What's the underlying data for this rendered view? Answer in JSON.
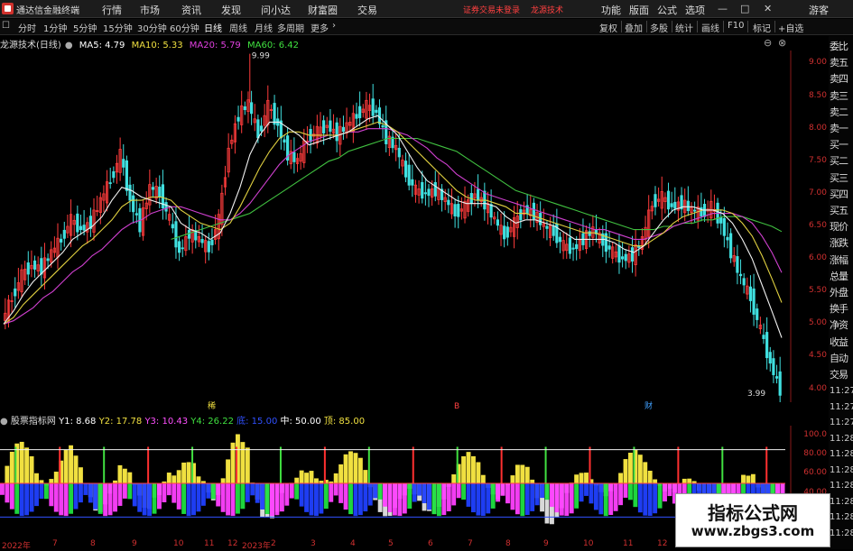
{
  "app": {
    "title": "通达信金融终端"
  },
  "menu": [
    "行情",
    "市场",
    "资讯",
    "发现",
    "问小达",
    "财富圈",
    "交易"
  ],
  "warning": [
    "证券交易未登录",
    "龙源技术"
  ],
  "right_buttons": [
    "功能",
    "版面",
    "公式",
    "选项"
  ],
  "guest": "游客",
  "toolbar": {
    "periods": [
      "分时",
      "1分钟",
      "5分钟",
      "15分钟",
      "30分钟",
      "60分钟",
      "日线",
      "周线",
      "月线",
      "多周期",
      "更多"
    ],
    "active_period": "日线",
    "right": [
      "复权",
      "叠加",
      "多股",
      "统计",
      "画线",
      "F10",
      "标记",
      "+自选"
    ]
  },
  "legend": {
    "name": "龙源技术(日线)",
    "items": [
      {
        "label": "MA5: 4.79",
        "color": "#ffffff"
      },
      {
        "label": "MA10: 5.33",
        "color": "#f0e040"
      },
      {
        "label": "MA20: 5.79",
        "color": "#e040e0"
      },
      {
        "label": "MA60: 6.42",
        "color": "#40e040"
      }
    ]
  },
  "annotations": {
    "high": "9.99",
    "low": "3.99",
    "markers": [
      "稀",
      "B",
      "财"
    ]
  },
  "sublegend": {
    "name": "股票指标网",
    "items": [
      {
        "label": "Y1: 8.68",
        "color": "#ffffff"
      },
      {
        "label": "Y2: 17.78",
        "color": "#f0e040"
      },
      {
        "label": "Y3: 10.43",
        "color": "#ff50ff"
      },
      {
        "label": "Y4: 26.22",
        "color": "#40e040"
      },
      {
        "label": "底: 15.00",
        "color": "#3050ff"
      },
      {
        "label": "中: 50.00",
        "color": "#ffffff"
      },
      {
        "label": "顶: 85.00",
        "color": "#f0e040"
      }
    ]
  },
  "price_axis": [
    "9.00",
    "8.50",
    "8.00",
    "7.50",
    "7.00",
    "6.50",
    "6.00",
    "5.50",
    "5.00",
    "4.50",
    "4.00"
  ],
  "sub_axis": [
    "100.0",
    "80.00",
    "60.00",
    "40.00",
    "20.00"
  ],
  "xaxis": [
    "2022年",
    "7",
    "8",
    "9",
    "10",
    "11",
    "12",
    "2023年",
    "2",
    "3",
    "4",
    "5",
    "6",
    "7",
    "8",
    "9",
    "10",
    "11",
    "12"
  ],
  "sidebar": [
    "委比",
    "卖五",
    "卖四",
    "卖三",
    "卖二",
    "卖一",
    "买一",
    "买二",
    "买三",
    "买四",
    "买五",
    "现价",
    "涨跌",
    "涨幅",
    "总量",
    "外盘",
    "换手",
    "净资",
    "收益",
    "自动",
    "交易"
  ],
  "sidebar_times": [
    "11:27",
    "11:27",
    "11:27",
    "11:28",
    "11:28",
    "11:28",
    "11:28",
    "11:28",
    "11:28",
    "11:28"
  ],
  "watermark": {
    "line1": "指标公式网",
    "line2": "www.zbgs3.com"
  },
  "chart_data": {
    "type": "candlestick",
    "ylim": [
      3.8,
      9.2
    ],
    "close": [
      5.05,
      5.4,
      5.75,
      5.9,
      5.85,
      6.1,
      6.3,
      6.6,
      6.45,
      6.55,
      6.9,
      7.2,
      7.6,
      6.9,
      6.5,
      7.1,
      7.0,
      6.6,
      6.1,
      6.4,
      6.3,
      6.15,
      6.6,
      7.7,
      8.2,
      8.4,
      7.9,
      8.35,
      8.05,
      7.6,
      7.5,
      7.85,
      7.95,
      8.05,
      7.9,
      8.05,
      8.2,
      8.35,
      8.25,
      7.85,
      7.7,
      7.3,
      7.05,
      7.0,
      7.05,
      6.9,
      6.7,
      6.8,
      7.0,
      6.85,
      6.6,
      6.35,
      6.55,
      6.75,
      6.7,
      6.5,
      6.4,
      6.2,
      6.15,
      6.3,
      6.45,
      6.25,
      6.1,
      6.0,
      6.05,
      6.3,
      6.85,
      6.95,
      6.8,
      6.85,
      6.75,
      6.7,
      6.8,
      6.55,
      6.1,
      5.7,
      5.4,
      4.9,
      4.4,
      3.99
    ],
    "ma5": [
      5.0,
      5.2,
      5.45,
      5.65,
      5.8,
      5.95,
      6.1,
      6.3,
      6.4,
      6.5,
      6.65,
      6.9,
      7.1,
      7.05,
      6.95,
      6.9,
      6.85,
      6.8,
      6.55,
      6.45,
      6.4,
      6.3,
      6.4,
      6.7,
      7.1,
      7.6,
      7.9,
      8.1,
      8.1,
      8.0,
      7.9,
      7.75,
      7.8,
      7.85,
      7.9,
      7.95,
      8.05,
      8.15,
      8.2,
      8.05,
      7.9,
      7.65,
      7.4,
      7.2,
      7.1,
      7.0,
      6.9,
      6.85,
      6.85,
      6.85,
      6.8,
      6.65,
      6.55,
      6.6,
      6.6,
      6.55,
      6.5,
      6.4,
      6.3,
      6.3,
      6.3,
      6.3,
      6.25,
      6.15,
      6.1,
      6.2,
      6.4,
      6.6,
      6.75,
      6.8,
      6.8,
      6.75,
      6.75,
      6.7,
      6.55,
      6.3,
      6.0,
      5.6,
      5.2,
      4.79
    ],
    "ma10": [
      5.0,
      5.1,
      5.3,
      5.45,
      5.6,
      5.75,
      5.9,
      6.05,
      6.2,
      6.3,
      6.45,
      6.6,
      6.8,
      6.9,
      6.9,
      6.95,
      6.95,
      6.9,
      6.75,
      6.65,
      6.55,
      6.5,
      6.45,
      6.55,
      6.8,
      7.1,
      7.4,
      7.65,
      7.85,
      7.95,
      7.95,
      7.9,
      7.9,
      7.9,
      7.9,
      7.95,
      8.0,
      8.05,
      8.1,
      8.05,
      7.95,
      7.8,
      7.65,
      7.5,
      7.35,
      7.2,
      7.05,
      6.95,
      6.9,
      6.9,
      6.85,
      6.8,
      6.7,
      6.7,
      6.65,
      6.6,
      6.55,
      6.5,
      6.45,
      6.4,
      6.4,
      6.35,
      6.3,
      6.25,
      6.2,
      6.2,
      6.3,
      6.4,
      6.55,
      6.65,
      6.7,
      6.75,
      6.75,
      6.75,
      6.7,
      6.55,
      6.35,
      6.05,
      5.7,
      5.33
    ],
    "ma20": [
      5.0,
      5.05,
      5.15,
      5.25,
      5.4,
      5.5,
      5.65,
      5.8,
      5.9,
      6.05,
      6.15,
      6.3,
      6.45,
      6.55,
      6.6,
      6.7,
      6.75,
      6.8,
      6.8,
      6.75,
      6.7,
      6.65,
      6.6,
      6.6,
      6.7,
      6.85,
      7.05,
      7.25,
      7.45,
      7.6,
      7.7,
      7.8,
      7.85,
      7.9,
      7.9,
      7.95,
      7.95,
      8.0,
      8.0,
      8.0,
      7.95,
      7.9,
      7.8,
      7.7,
      7.55,
      7.45,
      7.3,
      7.2,
      7.1,
      7.0,
      6.95,
      6.9,
      6.85,
      6.8,
      6.75,
      6.7,
      6.65,
      6.6,
      6.55,
      6.5,
      6.45,
      6.45,
      6.4,
      6.35,
      6.3,
      6.3,
      6.35,
      6.4,
      6.5,
      6.55,
      6.6,
      6.65,
      6.7,
      6.7,
      6.7,
      6.65,
      6.55,
      6.35,
      6.1,
      5.79
    ],
    "ma60": [
      null,
      null,
      null,
      null,
      null,
      null,
      null,
      null,
      null,
      null,
      null,
      null,
      null,
      null,
      null,
      null,
      null,
      6.3,
      6.35,
      6.4,
      6.45,
      6.5,
      6.55,
      6.6,
      6.65,
      6.7,
      6.8,
      6.9,
      7.0,
      7.1,
      7.2,
      7.3,
      7.4,
      7.5,
      7.55,
      7.65,
      7.7,
      7.75,
      7.8,
      7.85,
      7.85,
      7.85,
      7.85,
      7.8,
      7.75,
      7.7,
      7.65,
      7.55,
      7.45,
      7.35,
      7.25,
      7.15,
      7.05,
      7.0,
      6.95,
      6.9,
      6.85,
      6.8,
      6.75,
      6.7,
      6.65,
      6.6,
      6.55,
      6.5,
      6.45,
      6.45,
      6.45,
      6.5,
      6.5,
      6.55,
      6.55,
      6.6,
      6.6,
      6.65,
      6.65,
      6.65,
      6.6,
      6.55,
      6.5,
      6.42
    ]
  }
}
